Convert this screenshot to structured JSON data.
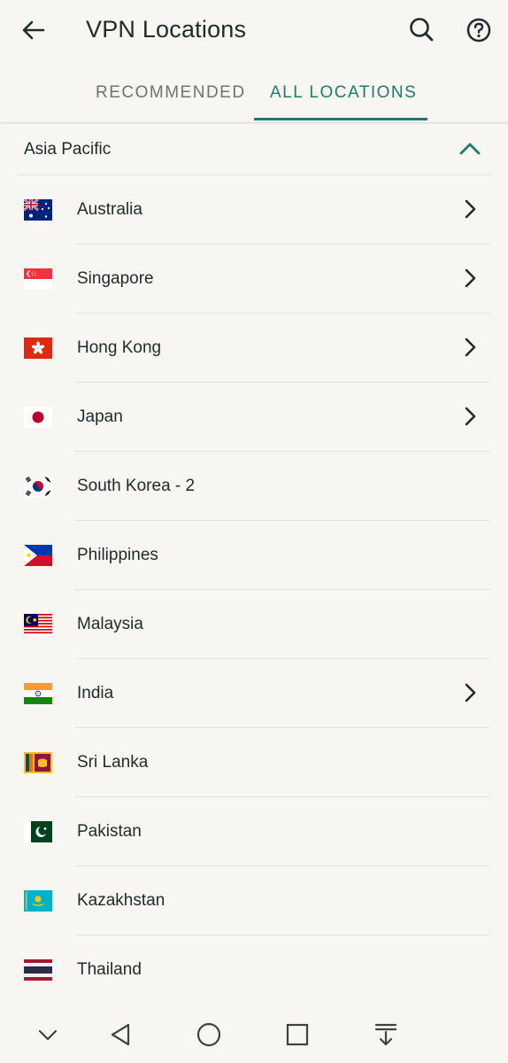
{
  "header": {
    "title": "VPN Locations"
  },
  "tabs": [
    {
      "label": "RECOMMENDED",
      "active": false
    },
    {
      "label": "ALL LOCATIONS",
      "active": true
    }
  ],
  "region": {
    "label": "Asia Pacific",
    "expanded": true
  },
  "locations": [
    {
      "name": "Australia",
      "flag": "australia-flag",
      "has_submenu": true
    },
    {
      "name": "Singapore",
      "flag": "singapore-flag",
      "has_submenu": true
    },
    {
      "name": "Hong Kong",
      "flag": "hong-kong-flag",
      "has_submenu": true
    },
    {
      "name": "Japan",
      "flag": "japan-flag",
      "has_submenu": true
    },
    {
      "name": "South Korea - 2",
      "flag": "south-korea-flag",
      "has_submenu": false
    },
    {
      "name": "Philippines",
      "flag": "philippines-flag",
      "has_submenu": false
    },
    {
      "name": "Malaysia",
      "flag": "malaysia-flag",
      "has_submenu": false
    },
    {
      "name": "India",
      "flag": "india-flag",
      "has_submenu": true
    },
    {
      "name": "Sri Lanka",
      "flag": "sri-lanka-flag",
      "has_submenu": false
    },
    {
      "name": "Pakistan",
      "flag": "pakistan-flag",
      "has_submenu": false
    },
    {
      "name": "Kazakhstan",
      "flag": "kazakhstan-flag",
      "has_submenu": false
    },
    {
      "name": "Thailand",
      "flag": "thailand-flag",
      "has_submenu": false
    }
  ],
  "colors": {
    "accent": "#1f7a68",
    "background": "#f7f6f2",
    "text": "#1f2a2a"
  },
  "system_nav": [
    "chevron-down-icon",
    "back-triangle-icon",
    "home-circle-icon",
    "recents-square-icon",
    "notification-pull-icon"
  ]
}
